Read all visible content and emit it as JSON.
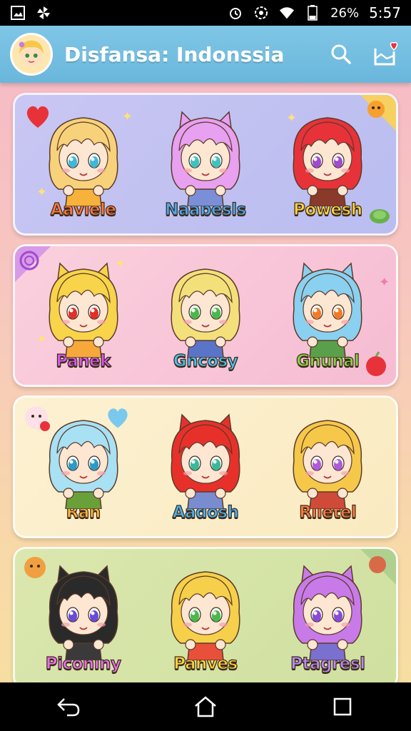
{
  "status_bar": {
    "battery": "26%",
    "time": "5:57"
  },
  "app_bar": {
    "title": "Disfansa: Indonssia"
  },
  "colors": {
    "app_bar": "#6ab7dc",
    "card_1": "#c7c3f0",
    "card_2": "#f8c6d8",
    "card_3": "#fbeecb",
    "card_4": "#d6e4a8"
  },
  "cards": [
    {
      "characters": [
        {
          "name": "Aavlele",
          "name_color": "#ff7a3d",
          "hair": "#f7d27a",
          "eyes": "#3db8d8",
          "outfit": "#f6b23a"
        },
        {
          "name": "Naabesls",
          "name_color": "#4aa8f0",
          "hair": "#e8a0f0",
          "eyes": "#3fc1c0",
          "outfit": "#7a8fd8"
        },
        {
          "name": "Powesh",
          "name_color": "#ffd23a",
          "hair": "#e8323a",
          "eyes": "#a04ad0",
          "outfit": "#8a3a2a"
        }
      ]
    },
    {
      "characters": [
        {
          "name": "Pahek",
          "name_color": "#d85ae8",
          "hair": "#f7d44a",
          "eyes": "#e0302a",
          "outfit": "#f6a83a"
        },
        {
          "name": "Gncosy",
          "name_color": "#4ac0f0",
          "hair": "#f4e07a",
          "eyes": "#4ab84a",
          "outfit": "#5a74c8"
        },
        {
          "name": "Ghunal",
          "name_color": "#8ad04a",
          "hair": "#8ad0f0",
          "eyes": "#f07a2a",
          "outfit": "#5aa04a"
        }
      ]
    },
    {
      "characters": [
        {
          "name": "Ran",
          "name_color": "#ffb43a",
          "hair": "#a8e0f4",
          "eyes": "#2a9ac8",
          "outfit": "#6aa03a"
        },
        {
          "name": "Aadosh",
          "name_color": "#4ab0f0",
          "hair": "#e8302a",
          "eyes": "#3ab89a",
          "outfit": "#7a8cd0"
        },
        {
          "name": "Rlietel",
          "name_color": "#ff7a3d",
          "hair": "#f6c84a",
          "eyes": "#b05ad8",
          "outfit": "#d04a3a"
        }
      ]
    },
    {
      "characters": [
        {
          "name": "Piconiny",
          "name_color": "#e870e8",
          "hair": "#2a2a2a",
          "eyes": "#6a4ad8",
          "outfit": "#3a3a3a"
        },
        {
          "name": "Panves",
          "name_color": "#ffd23a",
          "hair": "#f6d04a",
          "eyes": "#4ab84a",
          "outfit": "#e8503a"
        },
        {
          "name": "Ptagresl",
          "name_color": "#b88af0",
          "hair": "#c87ae8",
          "eyes": "#8a4ad8",
          "outfit": "#7a70d0"
        }
      ]
    }
  ],
  "icons": {
    "status_left": [
      "gallery-icon",
      "pinwheel-icon"
    ],
    "status_right": [
      "alarm-icon",
      "data-saver-icon",
      "wifi-icon",
      "battery-icon"
    ],
    "app_actions": [
      "search-icon",
      "favorites-icon"
    ],
    "nav": [
      "back-icon",
      "home-icon",
      "recents-icon"
    ]
  }
}
